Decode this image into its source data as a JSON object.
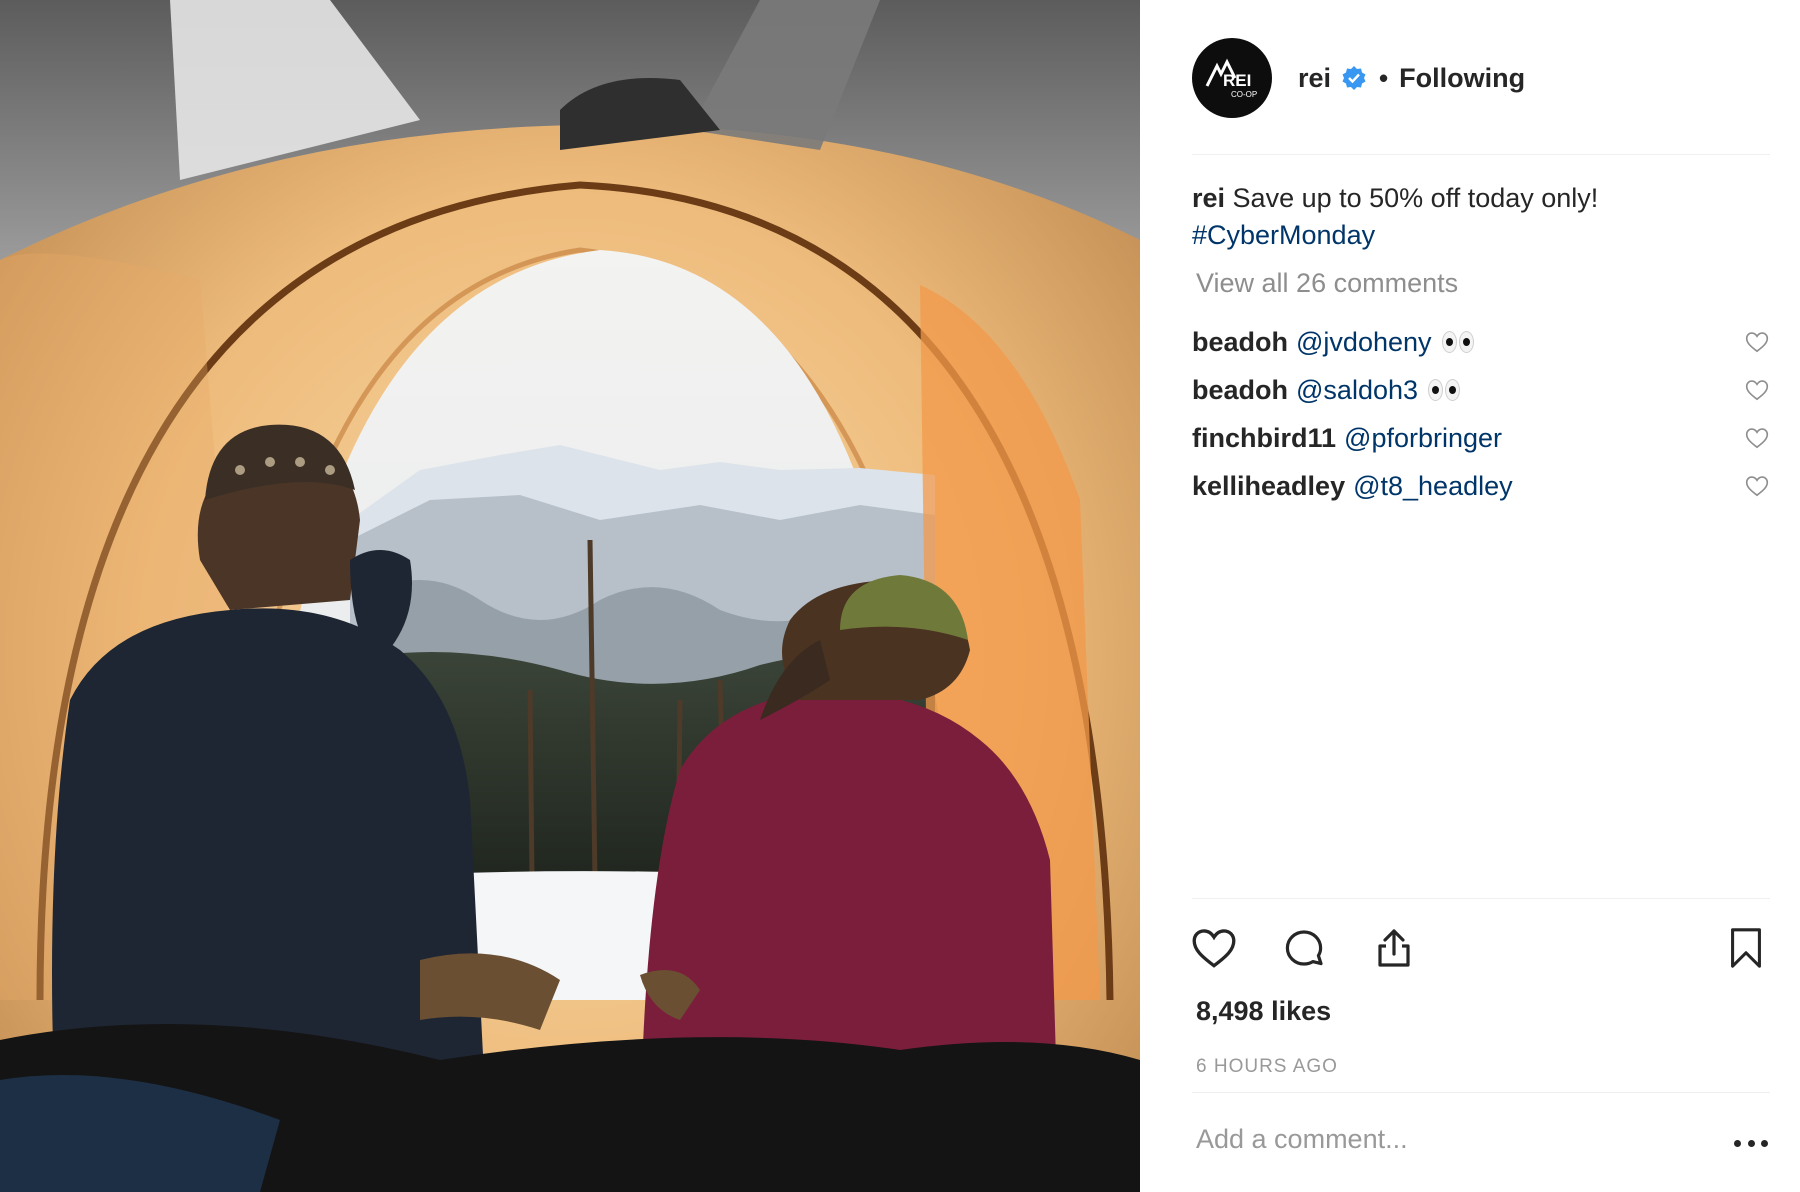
{
  "post": {
    "image_alt": "Two people sitting inside an orange tent looking out at snowy mountains",
    "author": {
      "username": "rei",
      "avatar_logo_text": "REI",
      "avatar_logo_subtext": "CO-OP",
      "verified": true,
      "follow_state": "Following"
    },
    "caption": {
      "username": "rei",
      "text": "Save up to 50% off today only!",
      "hashtag": "#CyberMonday"
    },
    "view_all_comments": "View all 26 comments",
    "comments": [
      {
        "username": "beadoh",
        "mention": "@jvdoheny",
        "emoji": "eyes"
      },
      {
        "username": "beadoh",
        "mention": "@saldoh3",
        "emoji": "eyes"
      },
      {
        "username": "finchbird11",
        "mention": "@pforbringer",
        "emoji": ""
      },
      {
        "username": "kelliheadley",
        "mention": "@t8_headley",
        "emoji": ""
      }
    ],
    "actions": {
      "like_icon": "heart-icon",
      "comment_icon": "comment-icon",
      "share_icon": "share-icon",
      "save_icon": "bookmark-icon"
    },
    "likes": "8,498 likes",
    "timestamp": "6 HOURS AGO",
    "add_comment_placeholder": "Add a comment...",
    "more_icon": "more-options-icon"
  },
  "colors": {
    "text": "#262626",
    "muted": "#999999",
    "link": "#003569",
    "verified": "#3897f0",
    "divider": "#efefef"
  }
}
